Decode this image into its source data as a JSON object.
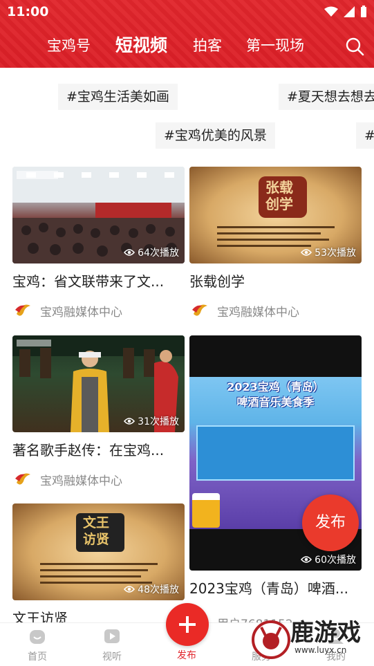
{
  "status": {
    "time": "11:00"
  },
  "nav": {
    "tabs": [
      {
        "label": "宝鸡号"
      },
      {
        "label": "短视频"
      },
      {
        "label": "拍客"
      },
      {
        "label": "第一现场"
      }
    ],
    "active": "短视频"
  },
  "topics": [
    "#宝鸡生活美如画",
    "#夏天想去想去",
    "#宝鸡优美的风景",
    "#"
  ],
  "cards": [
    {
      "title": "宝鸡：省文联带来了文...",
      "plays": "64次播放",
      "author": "宝鸡融媒体中心"
    },
    {
      "title": "张载创学",
      "plays": "53次播放",
      "author": "宝鸡融媒体中心",
      "thumb_heading": "张载\n创学"
    },
    {
      "title": "著名歌手赵传：在宝鸡...",
      "plays": "31次播放",
      "author": "宝鸡融媒体中心"
    },
    {
      "title": "2023宝鸡（青岛）啤酒...",
      "plays": "60次播放",
      "thumb_banner": "2023宝鸡（青岛）\n啤酒音乐美食季"
    },
    {
      "title": "文王访贤",
      "plays": "48次播放",
      "thumb_heading": "文王\n访贤"
    },
    {
      "author": "用户7681152"
    }
  ],
  "publish_fab": "发布",
  "bottom_nav": [
    "首页",
    "视听",
    "发布",
    "服务",
    "我的"
  ],
  "watermark": {
    "text": "鹿游戏",
    "url": "www.luyx.cn"
  },
  "colors": {
    "brand": "#e1262c",
    "muted": "#8a8a8a"
  }
}
